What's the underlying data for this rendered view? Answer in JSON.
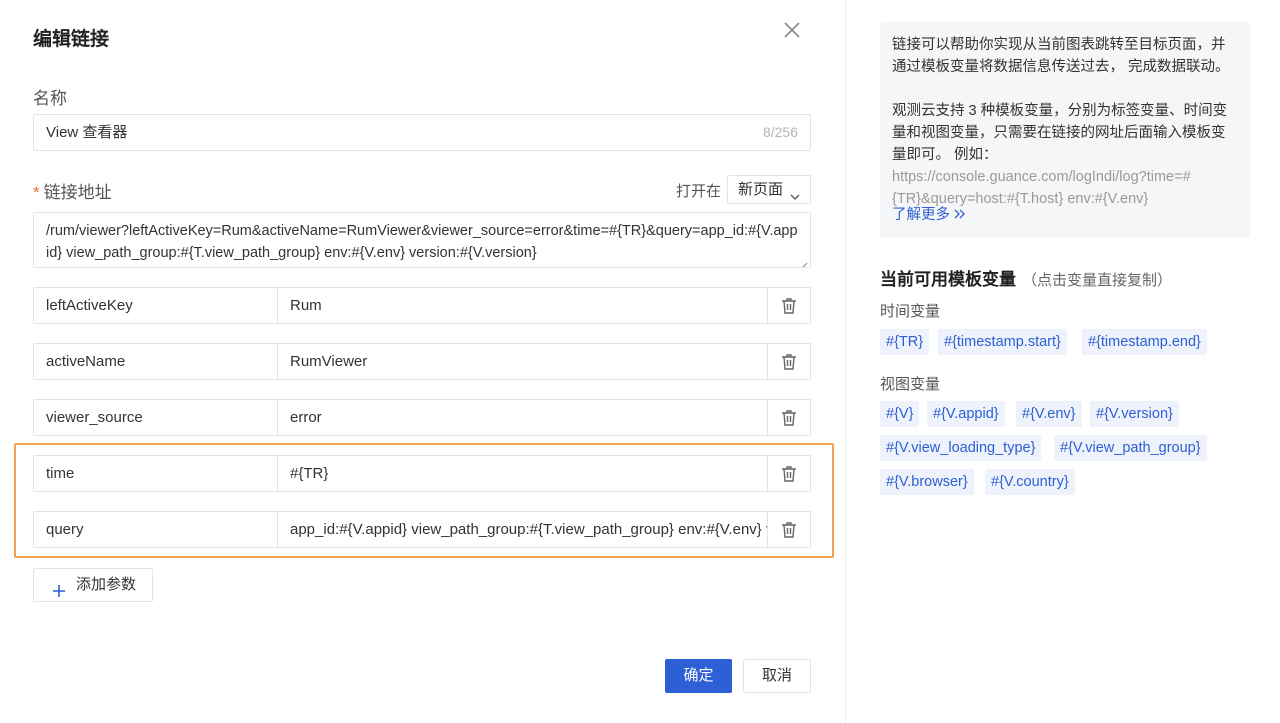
{
  "dialog": {
    "title": "编辑链接",
    "name_label": "名称",
    "name_value": "View 查看器",
    "name_counter": "8/256",
    "url_label": "链接地址",
    "url_required_mark": "*",
    "open_in_label": "打开在",
    "open_in_value": "新页面",
    "url_value": "/rum/viewer?leftActiveKey=Rum&activeName=RumViewer&viewer_source=error&time=#{TR}&query=app_id:#{V.appid} view_path_group:#{T.view_path_group} env:#{V.env} version:#{V.version}",
    "params": [
      {
        "key": "leftActiveKey",
        "value": "Rum"
      },
      {
        "key": "activeName",
        "value": "RumViewer"
      },
      {
        "key": "viewer_source",
        "value": "error"
      },
      {
        "key": "time",
        "value": "#{TR}"
      },
      {
        "key": "query",
        "value": "app_id:#{V.appid} view_path_group:#{T.view_path_group} env:#{V.env} version:#{V.version}"
      }
    ],
    "add_param_label": "添加参数",
    "ok_label": "确定",
    "cancel_label": "取消"
  },
  "help": {
    "para1": "链接可以帮助你实现从当前图表跳转至目标页面，并通过模板变量将数据信息传送过去， 完成数据联动。",
    "para2_text": "观测云支持 3 种模板变量，分别为标签变量、时间变量和视图变量，只需要在链接的网址后面输入模板变量即可。 例如：",
    "para2_url": "https://console.guance.com/logIndi/log?time=#{TR}&query=host:#{T.host} env:#{V.env}",
    "learn_more": "了解更多",
    "vars_title": "当前可用模板变量",
    "vars_hint": "（点击变量直接复制）",
    "time_vars_label": "时间变量",
    "time_vars": [
      "#{TR}",
      "#{timestamp.start}",
      "#{timestamp.end}"
    ],
    "view_vars_label": "视图变量",
    "view_vars": [
      "#{V}",
      "#{V.appid}",
      "#{V.env}",
      "#{V.version}",
      "#{V.view_loading_type}",
      "#{V.view_path_group}",
      "#{V.browser}",
      "#{V.country}"
    ]
  },
  "colors": {
    "primary": "#2d5fd6",
    "highlight": "#f0a44b",
    "required": "#e8743b"
  }
}
